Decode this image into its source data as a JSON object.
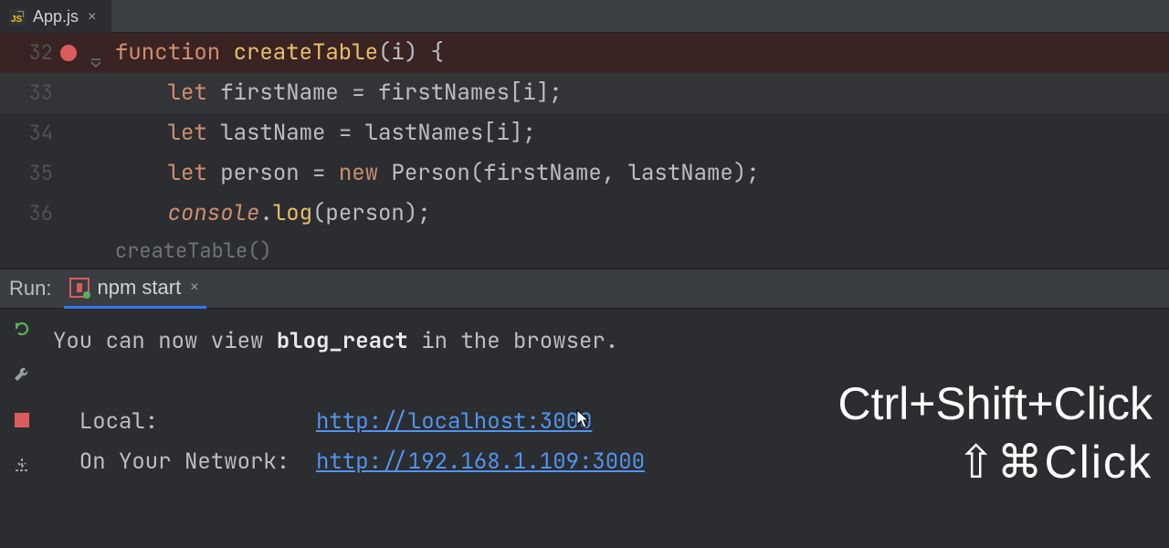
{
  "tab": {
    "filename": "App.js",
    "icon_text": "JS"
  },
  "editor": {
    "lines": [
      {
        "num": "32",
        "breakpoint": true,
        "fold": true,
        "tokens": "function createTable(i) {"
      },
      {
        "num": "33",
        "tokens": "    let firstName = firstNames[i];"
      },
      {
        "num": "34",
        "tokens": "    let lastName = lastNames[i];"
      },
      {
        "num": "35",
        "tokens": "    let person = new Person(firstName, lastName);"
      },
      {
        "num": "36",
        "tokens": "    console.log(person);"
      }
    ],
    "param_hint": "createTable()"
  },
  "run": {
    "panel_label": "Run:",
    "tab_label": "npm start",
    "output": {
      "line1_prefix": "You can now view ",
      "line1_bold": "blog_react",
      "line1_suffix": " in the browser.",
      "local_label": "  Local:            ",
      "local_url": "http://localhost:3000",
      "net_label": "  On Your Network:  ",
      "net_url": "http://192.168.1.109:3000"
    }
  },
  "shortcuts": {
    "win": "Ctrl+Shift+Click",
    "mac": "⇧⌘Click"
  }
}
